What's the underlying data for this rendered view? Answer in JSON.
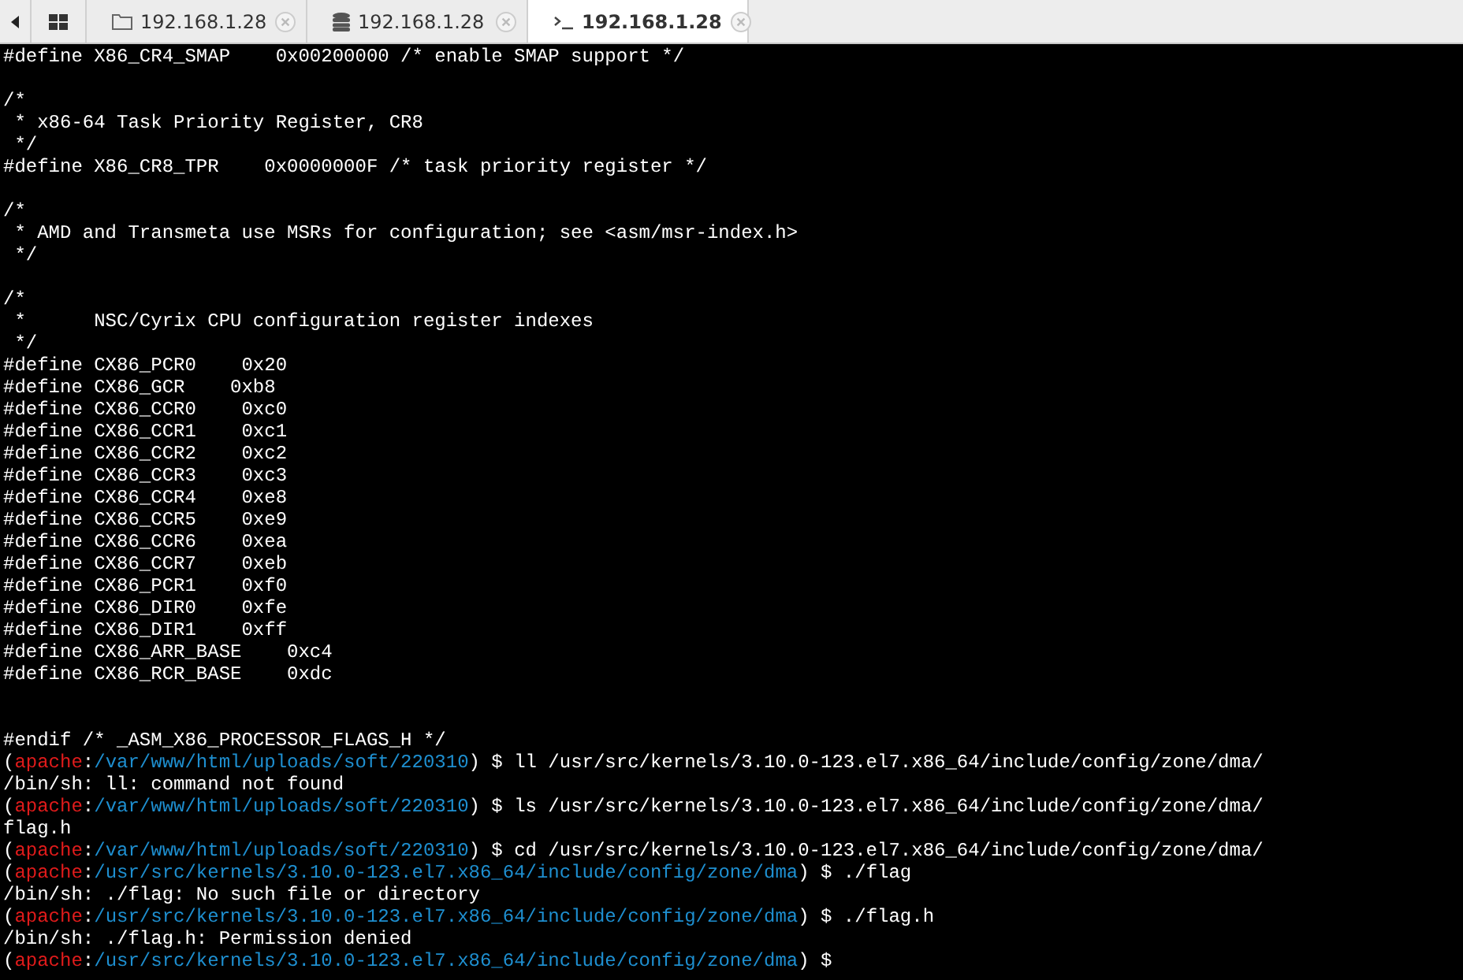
{
  "tabs": [
    {
      "kind": "folder",
      "label": "192.168.1.28",
      "selected": false
    },
    {
      "kind": "database",
      "label": "192.168.1.28",
      "selected": false
    },
    {
      "kind": "terminal",
      "label": "192.168.1.28",
      "selected": true
    }
  ],
  "terminal": {
    "lines": [
      [
        {
          "kind": "plain",
          "text": "#define X86_CR4_SMAP    0x00200000 /* enable SMAP support */"
        }
      ],
      [
        {
          "kind": "blank"
        }
      ],
      [
        {
          "kind": "plain",
          "text": "/*"
        }
      ],
      [
        {
          "kind": "plain",
          "text": " * x86-64 Task Priority Register, CR8"
        }
      ],
      [
        {
          "kind": "plain",
          "text": " */"
        }
      ],
      [
        {
          "kind": "plain",
          "text": "#define X86_CR8_TPR    0x0000000F /* task priority register */"
        }
      ],
      [
        {
          "kind": "blank"
        }
      ],
      [
        {
          "kind": "plain",
          "text": "/*"
        }
      ],
      [
        {
          "kind": "plain",
          "text": " * AMD and Transmeta use MSRs for configuration; see <asm/msr-index.h>"
        }
      ],
      [
        {
          "kind": "plain",
          "text": " */"
        }
      ],
      [
        {
          "kind": "blank"
        }
      ],
      [
        {
          "kind": "plain",
          "text": "/*"
        }
      ],
      [
        {
          "kind": "plain",
          "text": " *      NSC/Cyrix CPU configuration register indexes"
        }
      ],
      [
        {
          "kind": "plain",
          "text": " */"
        }
      ],
      [
        {
          "kind": "plain",
          "text": "#define CX86_PCR0    0x20"
        }
      ],
      [
        {
          "kind": "plain",
          "text": "#define CX86_GCR    0xb8"
        }
      ],
      [
        {
          "kind": "plain",
          "text": "#define CX86_CCR0    0xc0"
        }
      ],
      [
        {
          "kind": "plain",
          "text": "#define CX86_CCR1    0xc1"
        }
      ],
      [
        {
          "kind": "plain",
          "text": "#define CX86_CCR2    0xc2"
        }
      ],
      [
        {
          "kind": "plain",
          "text": "#define CX86_CCR3    0xc3"
        }
      ],
      [
        {
          "kind": "plain",
          "text": "#define CX86_CCR4    0xe8"
        }
      ],
      [
        {
          "kind": "plain",
          "text": "#define CX86_CCR5    0xe9"
        }
      ],
      [
        {
          "kind": "plain",
          "text": "#define CX86_CCR6    0xea"
        }
      ],
      [
        {
          "kind": "plain",
          "text": "#define CX86_CCR7    0xeb"
        }
      ],
      [
        {
          "kind": "plain",
          "text": "#define CX86_PCR1    0xf0"
        }
      ],
      [
        {
          "kind": "plain",
          "text": "#define CX86_DIR0    0xfe"
        }
      ],
      [
        {
          "kind": "plain",
          "text": "#define CX86_DIR1    0xff"
        }
      ],
      [
        {
          "kind": "plain",
          "text": "#define CX86_ARR_BASE    0xc4"
        }
      ],
      [
        {
          "kind": "plain",
          "text": "#define CX86_RCR_BASE    0xdc"
        }
      ],
      [
        {
          "kind": "blank"
        }
      ],
      [
        {
          "kind": "blank"
        }
      ],
      [
        {
          "kind": "plain",
          "text": "#endif /* _ASM_X86_PROCESSOR_FLAGS_H */"
        }
      ],
      [
        {
          "kind": "plain",
          "text": "("
        },
        {
          "kind": "user",
          "text": "apache"
        },
        {
          "kind": "plain",
          "text": ":"
        },
        {
          "kind": "path",
          "text": "/var/www/html/uploads/soft/220310"
        },
        {
          "kind": "plain",
          "text": ") $ ll /usr/src/kernels/3.10.0-123.el7.x86_64/include/config/zone/dma/"
        }
      ],
      [
        {
          "kind": "plain",
          "text": "/bin/sh: ll: command not found"
        }
      ],
      [
        {
          "kind": "plain",
          "text": "("
        },
        {
          "kind": "user",
          "text": "apache"
        },
        {
          "kind": "plain",
          "text": ":"
        },
        {
          "kind": "path",
          "text": "/var/www/html/uploads/soft/220310"
        },
        {
          "kind": "plain",
          "text": ") $ ls /usr/src/kernels/3.10.0-123.el7.x86_64/include/config/zone/dma/"
        }
      ],
      [
        {
          "kind": "plain",
          "text": "flag.h"
        }
      ],
      [
        {
          "kind": "plain",
          "text": "("
        },
        {
          "kind": "user",
          "text": "apache"
        },
        {
          "kind": "plain",
          "text": ":"
        },
        {
          "kind": "path",
          "text": "/var/www/html/uploads/soft/220310"
        },
        {
          "kind": "plain",
          "text": ") $ cd /usr/src/kernels/3.10.0-123.el7.x86_64/include/config/zone/dma/"
        }
      ],
      [
        {
          "kind": "plain",
          "text": "("
        },
        {
          "kind": "user",
          "text": "apache"
        },
        {
          "kind": "plain",
          "text": ":"
        },
        {
          "kind": "path",
          "text": "/usr/src/kernels/3.10.0-123.el7.x86_64/include/config/zone/dma"
        },
        {
          "kind": "plain",
          "text": ") $ ./flag"
        }
      ],
      [
        {
          "kind": "plain",
          "text": "/bin/sh: ./flag: No such file or directory"
        }
      ],
      [
        {
          "kind": "plain",
          "text": "("
        },
        {
          "kind": "user",
          "text": "apache"
        },
        {
          "kind": "plain",
          "text": ":"
        },
        {
          "kind": "path",
          "text": "/usr/src/kernels/3.10.0-123.el7.x86_64/include/config/zone/dma"
        },
        {
          "kind": "plain",
          "text": ") $ ./flag.h"
        }
      ],
      [
        {
          "kind": "plain",
          "text": "/bin/sh: ./flag.h: Permission denied"
        }
      ],
      [
        {
          "kind": "plain",
          "text": "("
        },
        {
          "kind": "user",
          "text": "apache"
        },
        {
          "kind": "plain",
          "text": ":"
        },
        {
          "kind": "path",
          "text": "/usr/src/kernels/3.10.0-123.el7.x86_64/include/config/zone/dma"
        },
        {
          "kind": "plain",
          "text": ") $"
        }
      ]
    ]
  }
}
